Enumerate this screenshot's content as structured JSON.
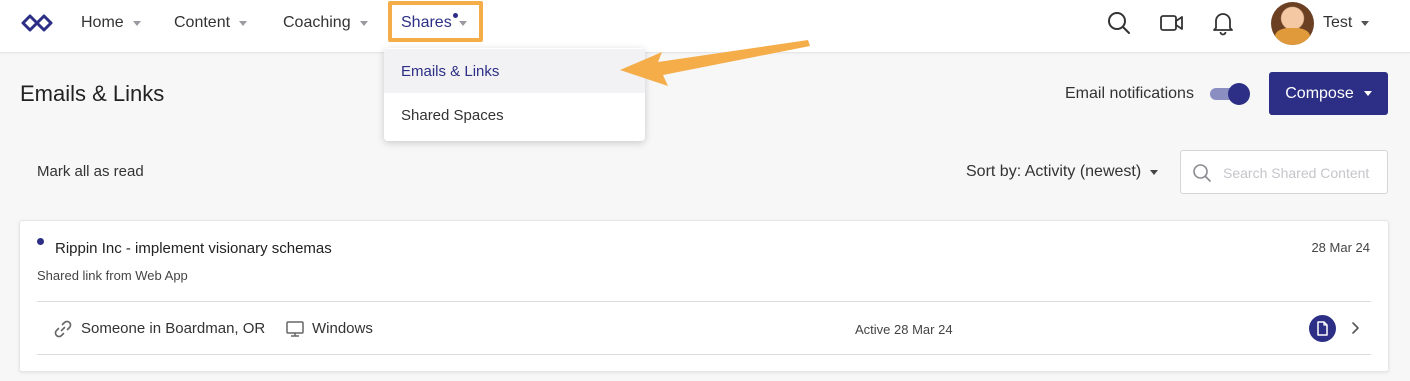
{
  "nav": {
    "items": [
      {
        "label": "Home"
      },
      {
        "label": "Content"
      },
      {
        "label": "Coaching"
      },
      {
        "label": "Shares"
      }
    ],
    "user_name": "Test"
  },
  "dropdown": {
    "items": [
      {
        "label": "Emails & Links"
      },
      {
        "label": "Shared Spaces"
      }
    ]
  },
  "page": {
    "title": "Emails & Links",
    "email_notifications_label": "Email notifications",
    "email_notifications_on": true,
    "compose_label": "Compose"
  },
  "controls": {
    "mark_all_read": "Mark all as read",
    "sort_by": "Sort by: Activity (newest)",
    "search_placeholder": "Search Shared Content"
  },
  "shares": [
    {
      "title": "Rippin Inc - implement visionary schemas",
      "date": "28 Mar 24",
      "subtitle": "Shared link from Web App",
      "viewer": "Someone in Boardman, OR",
      "os": "Windows",
      "active": "Active 28 Mar 24"
    }
  ],
  "colors": {
    "accent": "#2c2f85",
    "highlight": "#f5ad4a"
  },
  "icons": [
    "logo-icon",
    "search-icon",
    "video-icon",
    "bell-icon",
    "link-icon",
    "monitor-icon",
    "document-icon",
    "chevron-right-icon"
  ]
}
